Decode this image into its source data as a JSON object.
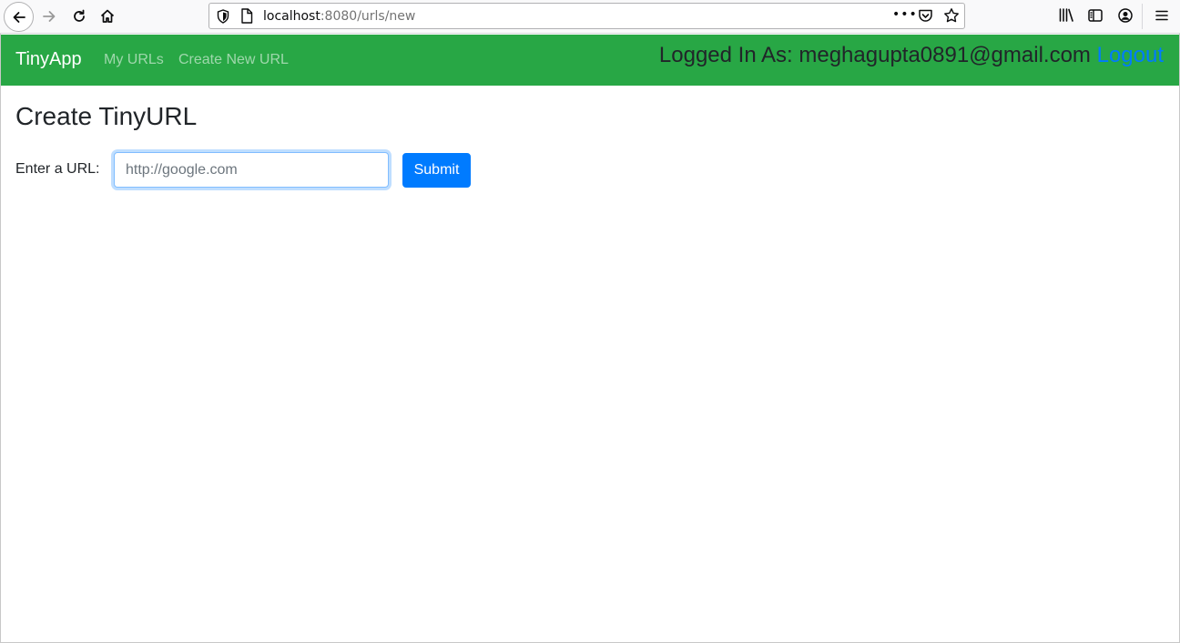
{
  "browser": {
    "url_host": "localhost",
    "url_rest": ":8080/urls/new",
    "more_label": "•••"
  },
  "navbar": {
    "brand": "TinyApp",
    "links": [
      {
        "label": "My URLs"
      },
      {
        "label": "Create New URL"
      }
    ],
    "logged_in_prefix": "Logged In As: meghagupta0891@gmail.com",
    "logout_label": "Logout",
    "colors": {
      "bar": "#28a745",
      "link": "#007bff"
    }
  },
  "main": {
    "title": "Create TinyURL",
    "form": {
      "label": "Enter a URL:",
      "placeholder": "http://google.com",
      "submit_label": "Submit",
      "submit_color": "#007bff"
    }
  }
}
